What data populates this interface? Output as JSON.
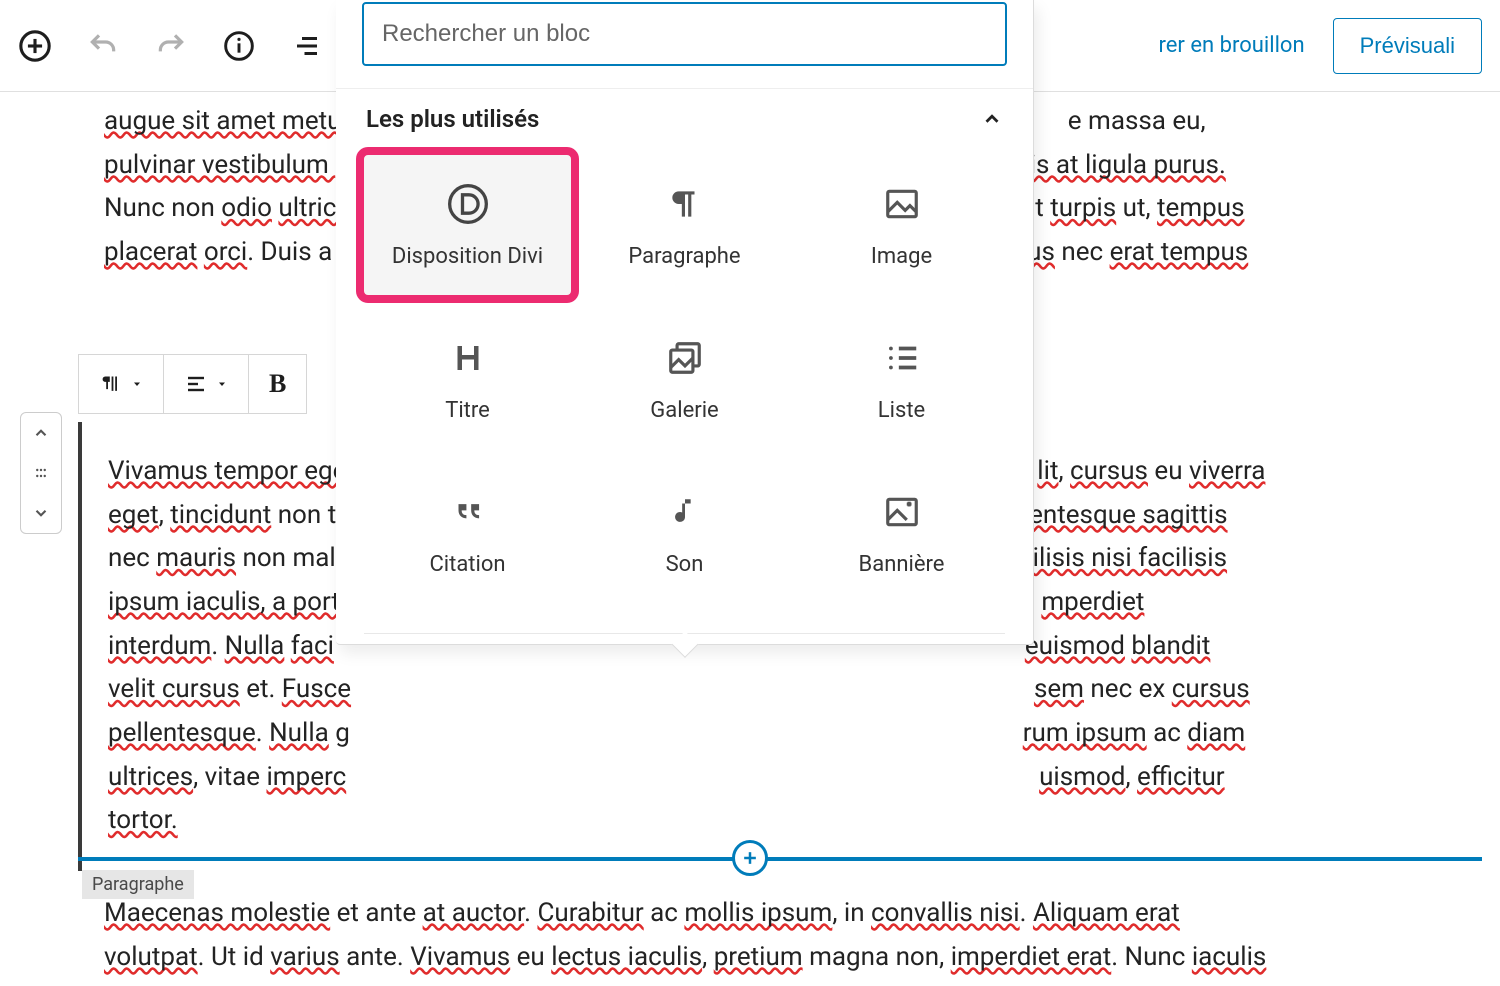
{
  "toolbar": {
    "save_draft": "rer en brouillon",
    "preview": "Prévisuali"
  },
  "search": {
    "placeholder": "Rechercher un bloc"
  },
  "popover": {
    "section_title": "Les plus utilisés",
    "blocks": [
      {
        "label": "Disposition Divi"
      },
      {
        "label": "Paragraphe"
      },
      {
        "label": "Image"
      },
      {
        "label": "Titre"
      },
      {
        "label": "Galerie"
      },
      {
        "label": "Liste"
      },
      {
        "label": "Citation"
      },
      {
        "label": "Son"
      },
      {
        "label": "Bannière"
      }
    ]
  },
  "block_toolbar": {
    "bold": "B"
  },
  "block_label": "Paragraphe",
  "paragraphs": {
    "p1_a": "augue sit amet metus",
    "p1_b": "e massa eu,",
    "p1_c": "pulvinar vestibulum ",
    "p1_d": "is at ligula purus.",
    "p1_e": "Nunc non odio ultric",
    "p1_f": "t turpis ut, tempus",
    "p1_g": "placerat orci. Duis a ",
    "p1_h": "us nec erat tempus",
    "p2_a": " Vivamus tempor ege",
    "p2_b": "lit, cursus eu viverra",
    "p2_c": "eget, tincidunt non t",
    "p2_d": "entesque sagittis",
    "p2_e": "nec mauris  non mal",
    "p2_f": "ilisis nisi facilisis",
    "p2_g": "ipsum iaculis, a portt",
    "p2_h": "mperdiet",
    "p2_i": "interdum. Nulla  faci",
    "p2_j": " euismod  blandit",
    "p2_k": "velit cursus et. Fusce",
    "p2_l": "sem nec ex cursus",
    "p2_m": "pellentesque. Nulla g",
    "p2_n": "rum ipsum ac diam",
    "p2_o": "ultrices, vitae imperc",
    "p2_p": "uismod, efficitur",
    "p2_q": "tortor.",
    "p3_a": " Maecenas molestie et ante at auctor. Curabitur ac mollis ipsum, in  convallis nisi. Aliquam erat",
    "p3_b": "volutpat. Ut id varius ante. Vivamus eu  lectus iaculis, pretium magna non, imperdiet erat. Nunc iaculis"
  }
}
